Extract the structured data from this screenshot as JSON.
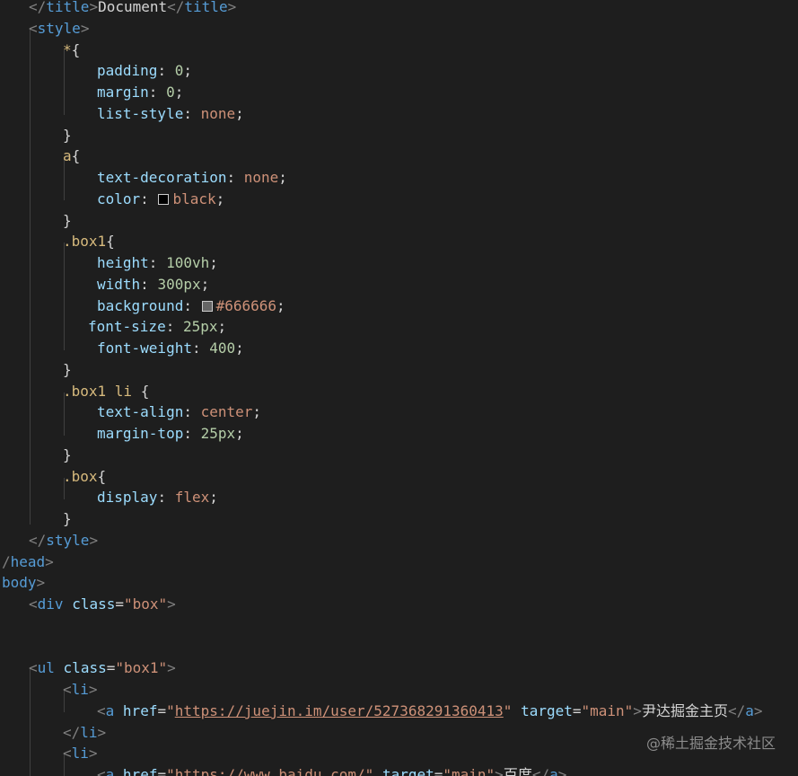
{
  "colors": {
    "background": "#1e1e1e",
    "punctuation": "#808080",
    "tag": "#569cd6",
    "selector": "#d7ba7d",
    "property": "#9cdcfe",
    "number": "#b5cea8",
    "keyword_value": "#ce9178",
    "text": "#d4d4d4"
  },
  "watermark": "@稀土掘金技术社区",
  "code_lines": [
    {
      "indent": 32,
      "tokens": [
        {
          "t": "</",
          "c": "punc"
        },
        {
          "t": "title",
          "c": "tag"
        },
        {
          "t": ">",
          "c": "punc"
        },
        {
          "t": "Document",
          "c": "text"
        },
        {
          "t": "</",
          "c": "punc"
        },
        {
          "t": "title",
          "c": "tag"
        },
        {
          "t": ">",
          "c": "punc"
        }
      ]
    },
    {
      "indent": 32,
      "tokens": [
        {
          "t": "<",
          "c": "punc"
        },
        {
          "t": "style",
          "c": "tag"
        },
        {
          "t": ">",
          "c": "punc"
        }
      ]
    },
    {
      "indent": 70,
      "tokens": [
        {
          "t": "*",
          "c": "sel"
        },
        {
          "t": "{",
          "c": "text"
        }
      ]
    },
    {
      "indent": 108,
      "tokens": [
        {
          "t": "padding",
          "c": "prop"
        },
        {
          "t": ": ",
          "c": "text"
        },
        {
          "t": "0",
          "c": "num"
        },
        {
          "t": ";",
          "c": "text"
        }
      ]
    },
    {
      "indent": 108,
      "tokens": [
        {
          "t": "margin",
          "c": "prop"
        },
        {
          "t": ": ",
          "c": "text"
        },
        {
          "t": "0",
          "c": "num"
        },
        {
          "t": ";",
          "c": "text"
        }
      ]
    },
    {
      "indent": 108,
      "tokens": [
        {
          "t": "list-style",
          "c": "prop"
        },
        {
          "t": ": ",
          "c": "text"
        },
        {
          "t": "none",
          "c": "kw"
        },
        {
          "t": ";",
          "c": "text"
        }
      ]
    },
    {
      "indent": 70,
      "tokens": [
        {
          "t": "}",
          "c": "text"
        }
      ]
    },
    {
      "indent": 70,
      "tokens": [
        {
          "t": "a",
          "c": "sel"
        },
        {
          "t": "{",
          "c": "text"
        }
      ]
    },
    {
      "indent": 108,
      "tokens": [
        {
          "t": "text-decoration",
          "c": "prop"
        },
        {
          "t": ": ",
          "c": "text"
        },
        {
          "t": "none",
          "c": "kw"
        },
        {
          "t": ";",
          "c": "text"
        }
      ]
    },
    {
      "indent": 108,
      "tokens": [
        {
          "t": "color",
          "c": "prop"
        },
        {
          "t": ": ",
          "c": "text"
        },
        {
          "swatch": "#000000"
        },
        {
          "t": "black",
          "c": "kw"
        },
        {
          "t": ";",
          "c": "text"
        }
      ]
    },
    {
      "indent": 70,
      "tokens": [
        {
          "t": "}",
          "c": "text"
        }
      ]
    },
    {
      "indent": 70,
      "tokens": [
        {
          "t": ".box1",
          "c": "sel"
        },
        {
          "t": "{",
          "c": "text"
        }
      ]
    },
    {
      "indent": 108,
      "tokens": [
        {
          "t": "height",
          "c": "prop"
        },
        {
          "t": ": ",
          "c": "text"
        },
        {
          "t": "100vh",
          "c": "num"
        },
        {
          "t": ";",
          "c": "text"
        }
      ]
    },
    {
      "indent": 108,
      "tokens": [
        {
          "t": "width",
          "c": "prop"
        },
        {
          "t": ": ",
          "c": "text"
        },
        {
          "t": "300px",
          "c": "num"
        },
        {
          "t": ";",
          "c": "text"
        }
      ]
    },
    {
      "indent": 108,
      "tokens": [
        {
          "t": "background",
          "c": "prop"
        },
        {
          "t": ": ",
          "c": "text"
        },
        {
          "swatch": "#666666"
        },
        {
          "t": "#666666",
          "c": "kw"
        },
        {
          "t": ";",
          "c": "text"
        }
      ]
    },
    {
      "indent": 98,
      "tokens": [
        {
          "t": "font-size",
          "c": "prop"
        },
        {
          "t": ": ",
          "c": "text"
        },
        {
          "t": "25px",
          "c": "num"
        },
        {
          "t": ";",
          "c": "text"
        }
      ]
    },
    {
      "indent": 108,
      "tokens": [
        {
          "t": "font-weight",
          "c": "prop"
        },
        {
          "t": ": ",
          "c": "text"
        },
        {
          "t": "400",
          "c": "num"
        },
        {
          "t": ";",
          "c": "text"
        }
      ]
    },
    {
      "indent": 70,
      "tokens": [
        {
          "t": "}",
          "c": "text"
        }
      ]
    },
    {
      "indent": 70,
      "tokens": [
        {
          "t": ".box1 li ",
          "c": "sel"
        },
        {
          "t": "{",
          "c": "text"
        }
      ]
    },
    {
      "indent": 108,
      "tokens": [
        {
          "t": "text-align",
          "c": "prop"
        },
        {
          "t": ": ",
          "c": "text"
        },
        {
          "t": "center",
          "c": "kw"
        },
        {
          "t": ";",
          "c": "text"
        }
      ]
    },
    {
      "indent": 108,
      "tokens": [
        {
          "t": "margin-top",
          "c": "prop"
        },
        {
          "t": ": ",
          "c": "text"
        },
        {
          "t": "25px",
          "c": "num"
        },
        {
          "t": ";",
          "c": "text"
        }
      ]
    },
    {
      "indent": 70,
      "tokens": [
        {
          "t": "}",
          "c": "text"
        }
      ]
    },
    {
      "indent": 70,
      "tokens": [
        {
          "t": ".box",
          "c": "sel"
        },
        {
          "t": "{",
          "c": "text"
        }
      ]
    },
    {
      "indent": 108,
      "tokens": [
        {
          "t": "display",
          "c": "prop"
        },
        {
          "t": ": ",
          "c": "text"
        },
        {
          "t": "flex",
          "c": "kw"
        },
        {
          "t": ";",
          "c": "text"
        }
      ]
    },
    {
      "indent": 70,
      "tokens": [
        {
          "t": "}",
          "c": "text"
        }
      ]
    },
    {
      "indent": 32,
      "tokens": [
        {
          "t": "</",
          "c": "punc"
        },
        {
          "t": "style",
          "c": "tag"
        },
        {
          "t": ">",
          "c": "punc"
        }
      ]
    },
    {
      "indent": 2,
      "tokens": [
        {
          "t": "/",
          "c": "punc"
        },
        {
          "t": "head",
          "c": "tag"
        },
        {
          "t": ">",
          "c": "punc"
        }
      ]
    },
    {
      "indent": 2,
      "tokens": [
        {
          "t": "body",
          "c": "tag"
        },
        {
          "t": ">",
          "c": "punc"
        }
      ]
    },
    {
      "indent": 32,
      "tokens": [
        {
          "t": "<",
          "c": "punc"
        },
        {
          "t": "div",
          "c": "tag"
        },
        {
          "t": " ",
          "c": "text"
        },
        {
          "t": "class",
          "c": "attr"
        },
        {
          "t": "=",
          "c": "text"
        },
        {
          "t": "\"box\"",
          "c": "str"
        },
        {
          "t": ">",
          "c": "punc"
        }
      ]
    },
    {
      "indent": 0,
      "tokens": []
    },
    {
      "indent": 0,
      "tokens": []
    },
    {
      "indent": 32,
      "tokens": [
        {
          "t": "<",
          "c": "punc"
        },
        {
          "t": "ul",
          "c": "tag"
        },
        {
          "t": " ",
          "c": "text"
        },
        {
          "t": "class",
          "c": "attr"
        },
        {
          "t": "=",
          "c": "text"
        },
        {
          "t": "\"box1\"",
          "c": "str"
        },
        {
          "t": ">",
          "c": "punc"
        }
      ]
    },
    {
      "indent": 70,
      "tokens": [
        {
          "t": "<",
          "c": "punc"
        },
        {
          "t": "li",
          "c": "tag"
        },
        {
          "t": ">",
          "c": "punc"
        }
      ]
    },
    {
      "indent": 108,
      "tokens": [
        {
          "t": "<",
          "c": "punc"
        },
        {
          "t": "a",
          "c": "tag"
        },
        {
          "t": " ",
          "c": "text"
        },
        {
          "t": "href",
          "c": "attr"
        },
        {
          "t": "=",
          "c": "text"
        },
        {
          "t": "\"",
          "c": "str"
        },
        {
          "t": "https://juejin.im/user/527368291360413",
          "c": "url"
        },
        {
          "t": "\"",
          "c": "str"
        },
        {
          "t": " ",
          "c": "text"
        },
        {
          "t": "target",
          "c": "attr"
        },
        {
          "t": "=",
          "c": "text"
        },
        {
          "t": "\"main\"",
          "c": "str"
        },
        {
          "t": ">",
          "c": "punc"
        },
        {
          "t": "尹达掘金主页",
          "c": "text"
        },
        {
          "t": "</",
          "c": "punc"
        },
        {
          "t": "a",
          "c": "tag"
        },
        {
          "t": ">",
          "c": "punc"
        }
      ]
    },
    {
      "indent": 70,
      "tokens": [
        {
          "t": "</",
          "c": "punc"
        },
        {
          "t": "li",
          "c": "tag"
        },
        {
          "t": ">",
          "c": "punc"
        }
      ]
    },
    {
      "indent": 70,
      "tokens": [
        {
          "t": "<",
          "c": "punc"
        },
        {
          "t": "li",
          "c": "tag"
        },
        {
          "t": ">",
          "c": "punc"
        }
      ]
    },
    {
      "indent": 108,
      "tokens": [
        {
          "t": "<",
          "c": "punc"
        },
        {
          "t": "a",
          "c": "tag"
        },
        {
          "t": " ",
          "c": "text"
        },
        {
          "t": "href",
          "c": "attr"
        },
        {
          "t": "=",
          "c": "text"
        },
        {
          "t": "\"",
          "c": "str"
        },
        {
          "t": "https://www.baidu.com/",
          "c": "url"
        },
        {
          "t": "\"",
          "c": "str"
        },
        {
          "t": " ",
          "c": "text"
        },
        {
          "t": "target",
          "c": "attr"
        },
        {
          "t": "=",
          "c": "text"
        },
        {
          "t": "\"main\"",
          "c": "str"
        },
        {
          "t": ">",
          "c": "punc"
        },
        {
          "t": "百度",
          "c": "text"
        },
        {
          "t": "</",
          "c": "punc"
        },
        {
          "t": "a",
          "c": "tag"
        },
        {
          "t": ">",
          "c": "punc"
        }
      ]
    }
  ]
}
